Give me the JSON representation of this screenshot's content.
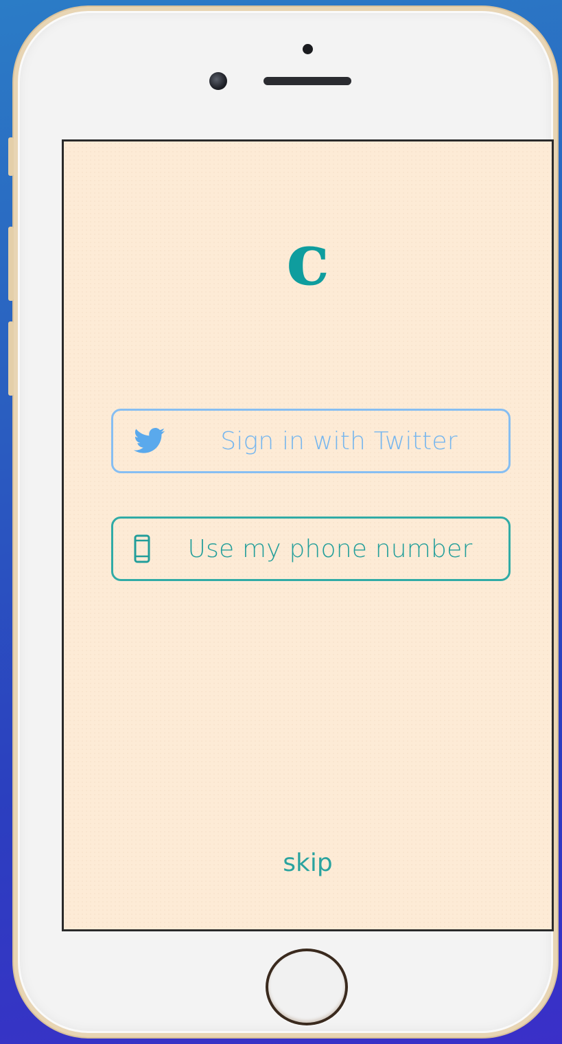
{
  "app": {
    "logo_text": "c",
    "accent_color": "#0f9d9e"
  },
  "login": {
    "twitter_button": {
      "label": "Sign in with Twitter",
      "icon": "twitter-bird-icon",
      "color": "#76b6ee"
    },
    "phone_button": {
      "label": "Use my phone number",
      "icon": "mobile-phone-icon",
      "color": "#229e9a"
    },
    "skip_label": "skip"
  },
  "device": {
    "screen_background": "#fdebd6",
    "frame_color": "#e8d5b4"
  }
}
